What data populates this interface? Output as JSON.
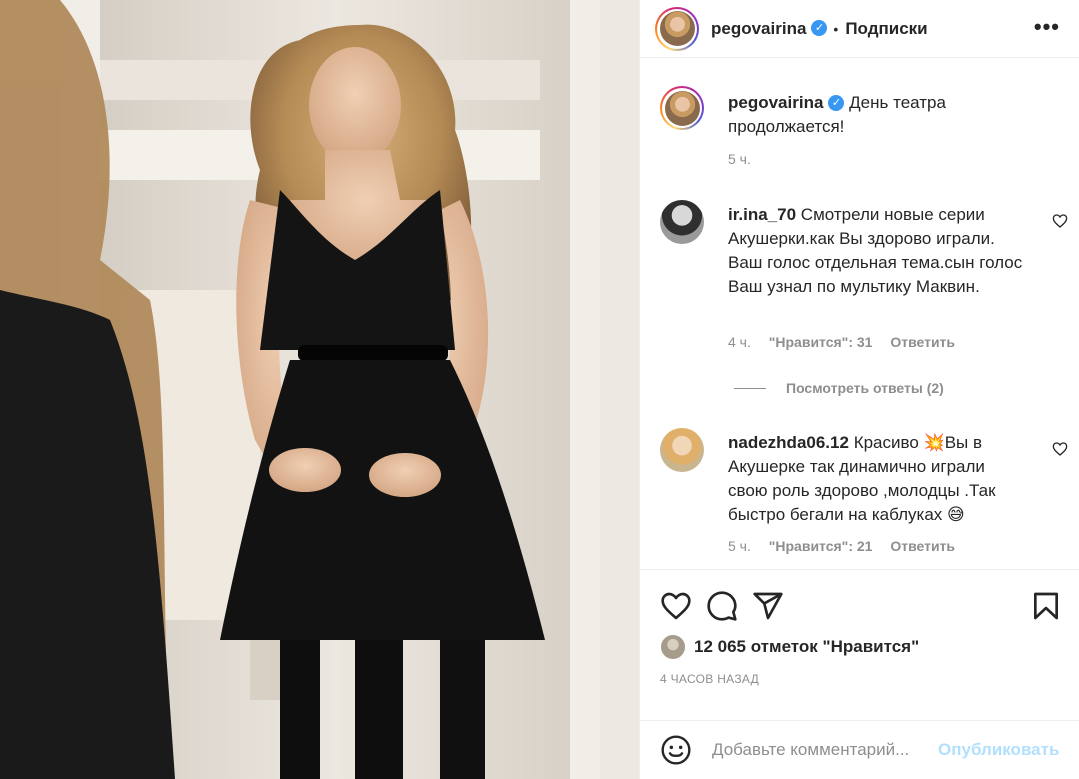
{
  "post": {
    "username": "pegovairina",
    "verified": true,
    "separator": "•",
    "follow_label": "Подписки",
    "more_label": "•••"
  },
  "caption": {
    "username": "pegovairina",
    "text": "День театра продолжается!",
    "time": "5 ч."
  },
  "comments": [
    {
      "username": "ir.ina_70",
      "text": "Смотрели новые серии Акушерки.как Вы здорово играли. Ваш голос отдельная тема.сын голос Ваш узнал по мультику Маквин.",
      "time": "4 ч.",
      "likes": "\"Нравится\": 31",
      "reply": "Ответить",
      "avatar_icon": "user-avatar-icon"
    },
    {
      "username": "nadezhda06.12",
      "text_part1": "Красиво ",
      "emoji1": "💥",
      "text_part2": "Вы в Акушерке так динамично играли свою роль здорово ,молодцы .Так быстро бегали на каблуках ",
      "emoji2": "😅",
      "time": "5 ч.",
      "likes": "\"Нравится\": 21",
      "reply": "Ответить",
      "avatar_icon": "user-avatar-icon"
    }
  ],
  "view_replies": "Посмотреть ответы (2)",
  "actions": {
    "like_icon": "heart-icon",
    "comment_icon": "comment-icon",
    "share_icon": "share-icon",
    "save_icon": "bookmark-icon"
  },
  "likes_summary": "12 065 отметок \"Нравится\"",
  "posted_ago": "4 ЧАСОВ НАЗАД",
  "comment_box": {
    "placeholder": "Добавьте комментарий...",
    "publish_label": "Опубликовать",
    "emoji_icon": "smiley-icon"
  },
  "colors": {
    "accent_blue": "#0095f6",
    "publish_disabled": "#b2dffc",
    "verified_blue": "#3897f0",
    "muted_text": "#8e8e8e"
  }
}
